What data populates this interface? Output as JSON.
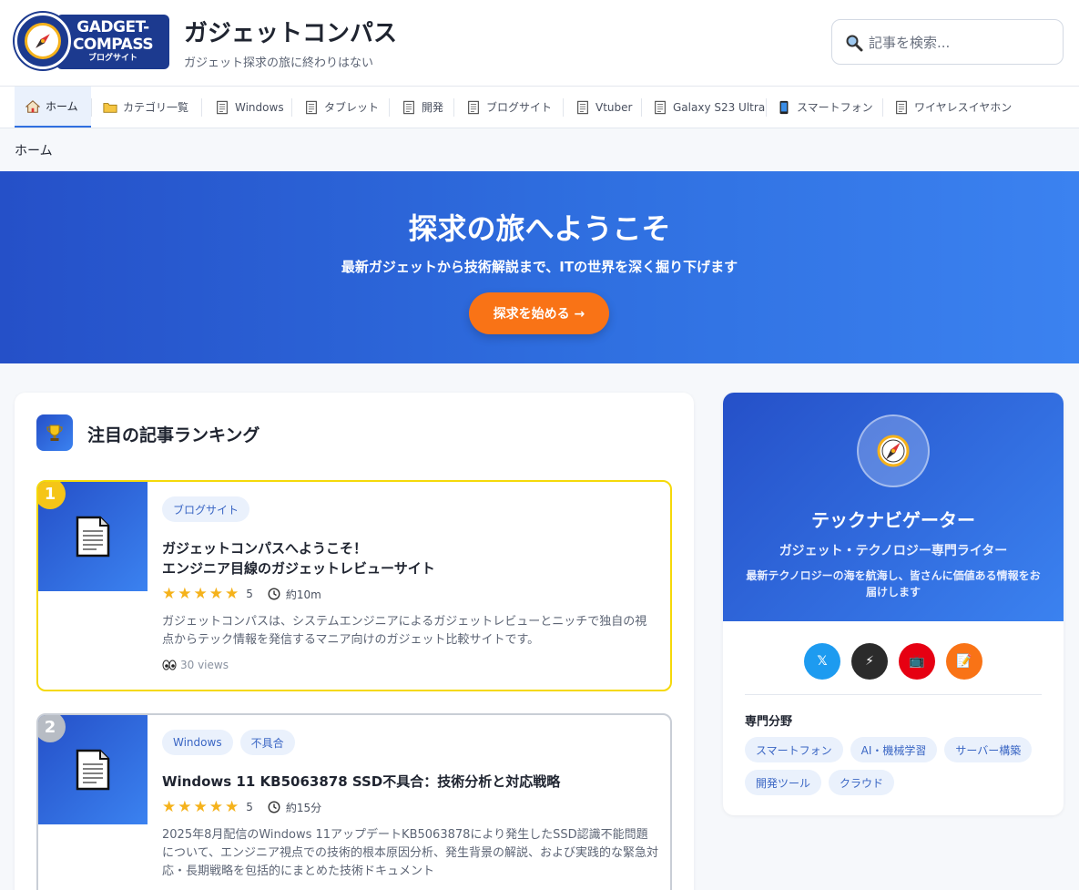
{
  "header": {
    "logo_line1": "GADGET-",
    "logo_line2": "COMPASS",
    "logo_line3": "ブログサイト",
    "site_title": "ガジェットコンパス",
    "tagline": "ガジェット探求の旅に終わりはない",
    "search_placeholder": "記事を検索..."
  },
  "nav": {
    "items": [
      {
        "label": "ホーム",
        "icon": "house-icon"
      },
      {
        "label": "カテゴリ一覧",
        "icon": "folder-icon"
      },
      {
        "label": "Windows",
        "icon": "document-icon"
      },
      {
        "label": "タブレット",
        "icon": "document-icon"
      },
      {
        "label": "開発",
        "icon": "document-icon"
      },
      {
        "label": "ブログサイト",
        "icon": "document-icon"
      },
      {
        "label": "Vtuber",
        "icon": "document-icon"
      },
      {
        "label": "Galaxy S23 Ultra",
        "icon": "document-icon"
      },
      {
        "label": "スマートフォン",
        "icon": "phone-icon"
      },
      {
        "label": "ワイヤレスイヤホン",
        "icon": "document-icon"
      }
    ]
  },
  "breadcrumb": "ホーム",
  "hero": {
    "title": "探求の旅へようこそ",
    "subtitle": "最新ガジェットから技術解説まで、ITの世界を深く掘り下げます",
    "button": "探求を始める →"
  },
  "ranking": {
    "title": "注目の記事ランキング",
    "articles": [
      {
        "rank": "1",
        "tags": [
          "ブログサイト"
        ],
        "title_line1": "ガジェットコンパスへようこそ！",
        "title_line2": "エンジニア目線のガジェットレビューサイト",
        "stars": "★★★★★",
        "rating": "5",
        "read_time": "約10m",
        "excerpt": "ガジェットコンパスは、システムエンジニアによるガジェットレビューとニッチで独自の視点からテック情報を発信するマニア向けのガジェット比較サイトです。",
        "views": "30 views"
      },
      {
        "rank": "2",
        "tags": [
          "Windows",
          "不具合"
        ],
        "title_line1": "Windows 11 KB5063878 SSD不具合：技術分析と対応戦略",
        "stars": "★★★★★",
        "rating": "5",
        "read_time": "約15分",
        "excerpt": "2025年8月配信のWindows 11アップデートKB5063878により発生したSSD認識不能問題について、エンジニア視点での技術的根本原因分析、発生背景の解説、および実践的な緊急対応・長期戦略を包括的にまとめた技術ドキュメント"
      }
    ]
  },
  "profile": {
    "name": "テックナビゲーター",
    "role": "ガジェット・テクノロジー専門ライター",
    "description": "最新テクノロジーの海を航海し、皆さんに価値ある情報をお届けします",
    "socials": [
      {
        "icon": "x-icon",
        "label": "𝕏",
        "color": "#1d9bf0"
      },
      {
        "icon": "lightning-icon",
        "label": "⚡",
        "color": "#2b2b2b"
      },
      {
        "icon": "tv-icon",
        "label": "📺",
        "color": "#e60012"
      },
      {
        "icon": "blog-icon",
        "label": "📝",
        "color": "#f97316"
      }
    ],
    "expertise_title": "専門分野",
    "expertise": [
      "スマートフォン",
      "AI・機械学習",
      "サーバー構築",
      "開発ツール",
      "クラウド"
    ]
  },
  "colors": {
    "brand_blue": "#2f6fe0",
    "accent_orange": "#f97316",
    "gold": "#f5c518"
  }
}
